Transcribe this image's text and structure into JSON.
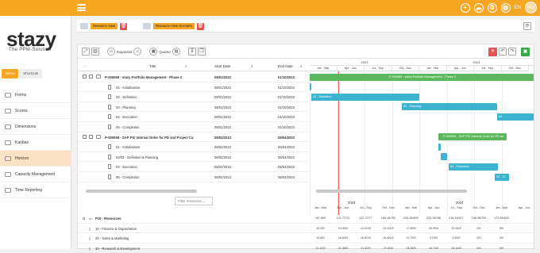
{
  "brand": {
    "name": "stazy",
    "tagline": "The PPM-Solution",
    "accent": "#f5a623"
  },
  "topbar": {
    "lang": "EN",
    "avatar": "HO"
  },
  "sidebar": {
    "tabs": [
      "Menu",
      "Shortcuts"
    ],
    "items": [
      {
        "label": "Forms",
        "icon": "forms-icon"
      },
      {
        "label": "Scores",
        "icon": "scores-icon"
      },
      {
        "label": "Dimensions",
        "icon": "dimensions-icon"
      },
      {
        "label": "Kanban",
        "icon": "kanban-icon"
      },
      {
        "label": "Horizon",
        "icon": "horizon-icon"
      },
      {
        "label": "Capacity Management",
        "icon": "capacity-icon"
      },
      {
        "label": "Time Reporting",
        "icon": "time-icon"
      }
    ]
  },
  "toolbar1": {
    "resource_view": "Resource View",
    "resource_view_scenario": "Resource View Scenario"
  },
  "toolbar2": {
    "expanded": "Expanded",
    "quarter": "Quarter"
  },
  "grid": {
    "headers": {
      "title": "Title",
      "start": "Start Date",
      "end": "End Date"
    },
    "rows": [
      {
        "title": "P-000069 - stazy Portfolio Management - Phase 2",
        "start": "08/01/2022",
        "end": "01/10/2023",
        "level": 0
      },
      {
        "title": "01 - Initialization",
        "start": "08/01/2022",
        "end": "01/10/2023",
        "level": 1
      },
      {
        "title": "02 - Definition",
        "start": "08/01/2022",
        "end": "01/10/2023",
        "level": 1
      },
      {
        "title": "03 - Planning",
        "start": "08/01/2022",
        "end": "01/10/2023",
        "level": 1
      },
      {
        "title": "04 - Execution",
        "start": "08/01/2022",
        "end": "01/10/2023",
        "level": 1
      },
      {
        "title": "05 - Completion",
        "start": "08/01/2022",
        "end": "01/10/2023",
        "level": 1
      },
      {
        "title": "P-000098 - SAP PS/ Internal Order for PD and Project Ca",
        "start": "08/02/2013",
        "end": "05/04/2023",
        "level": 0
      },
      {
        "title": "01 - Initialization",
        "start": "08/02/2013",
        "end": "05/04/2023",
        "level": 1
      },
      {
        "title": "02/03 - Definition & Planning",
        "start": "08/02/2013",
        "end": "05/04/2023",
        "level": 1
      },
      {
        "title": "04 - Execution",
        "start": "08/02/2013",
        "end": "05/04/2023",
        "level": 1
      },
      {
        "title": "05 - Completion",
        "start": "08/02/2013",
        "end": "05/04/2023",
        "level": 1
      }
    ]
  },
  "gantt": {
    "years": [
      "2023",
      "2024"
    ],
    "quarters": [
      "Jan - Mar",
      "Apr - Jun",
      "Jul - Sep",
      "Oct - Dec",
      "Jan - Mar",
      "Apr - Jun",
      "Jul - Sep",
      "Oct - Dec"
    ],
    "bars": [
      "P-000069 - stazy Portfolio Management - Phase 2",
      "02 - Definition",
      "03 - Planning",
      "04",
      "P-000098 - SAP PS/ Internal Order for PD an",
      "04 - Execution",
      "05 - Cr"
    ]
  },
  "lower": {
    "filter": "Filter resources",
    "years": [
      "2023",
      "2024"
    ],
    "quarters": [
      "Jan - Mar",
      "Apr - Jun",
      "Jul - Sep",
      "Oct - Dec",
      "Jan - Mar",
      "Apr - Jun",
      "Jul - Sep",
      "Oct - Dec",
      "Jan - Mar",
      "Apr - Jun"
    ],
    "rows": [
      {
        "title": "P10 - Resources",
        "vals": [
          "157.8/0f",
          "121.7/774",
          "122.7/277",
          "184.16/752",
          "625.45/609",
          "220.78/796",
          "218.16/977",
          "158.95/752",
          "172.83/629",
          ""
        ]
      },
      {
        "title": "10 - Finance & Organization",
        "vals": [
          "16.3/0",
          "14.99/0",
          "14.4/1/0",
          "14.4/1/0",
          "17.89/0",
          "20.99/0",
          "23.54/0",
          "0/0",
          "0/0",
          ""
        ]
      },
      {
        "title": "20 - Sales & Marketing",
        "vals": [
          "19.8/0",
          "16.63/0",
          "16.8/1/0",
          "16.8/1/0",
          "13.76/0",
          "3.24/0",
          "3.35/0",
          "0/0",
          "0/0",
          ""
        ]
      },
      {
        "title": "30 - Research & Development",
        "vals": [
          "21.42/0",
          "21.38/0",
          "21.62/0",
          "21.62/0",
          "24.06/0",
          "24.71/0",
          "24.16/0",
          "0/0",
          "0/0",
          ""
        ]
      }
    ]
  }
}
